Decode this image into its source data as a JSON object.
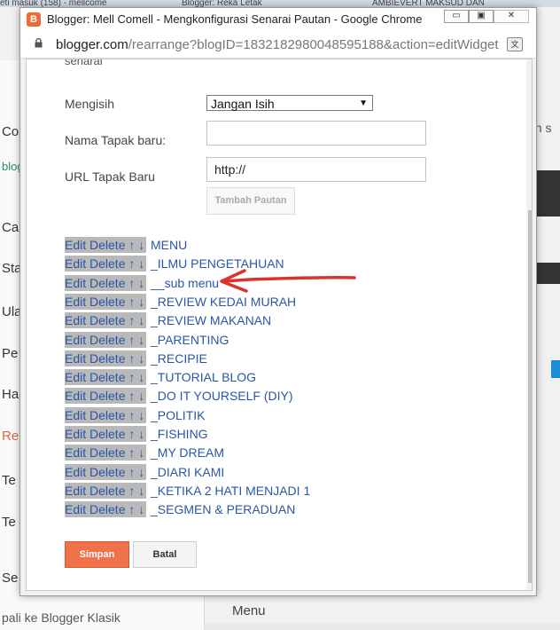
{
  "background": {
    "tabs": [
      "eti masuk (158) - mellcome",
      "Blogger: Reka Letak",
      "AMBIEVERT MAKSUD DAN"
    ],
    "left_menu": [
      "Co",
      "Ca",
      "Sta",
      "Ula",
      "Pe",
      "Ha",
      "Re",
      "Te",
      "Te",
      "Se"
    ],
    "left_bottom": "pali ke Blogger Klasik",
    "right_texts": [
      "an s",
      "Menu"
    ],
    "blog_text": "blog"
  },
  "window": {
    "title": "Blogger: Mell Comell - Mengkonfigurasi Senarai Pautan - Google Chrome",
    "url_host": "blogger.com",
    "url_path": "/rearrange?blogID=1832182980048595188&action=editWidget&...",
    "minimize": "▭",
    "maximize": "▣",
    "close": "✕"
  },
  "form": {
    "cut_label": "senarai",
    "sort_label": "Mengisih",
    "sort_value": "Jangan Isih",
    "name_label": "Nama Tapak baru:",
    "name_value": "",
    "url_label": "URL Tapak Baru",
    "url_value": "http://",
    "add_button": "Tambah Pautan"
  },
  "links": {
    "edit_label": "Edit",
    "delete_label": "Delete",
    "up_label": "↑",
    "down_label": "↓",
    "items": [
      "MENU",
      "_ILMU PENGETAHUAN",
      "__sub menu",
      "_REVIEW KEDAI MURAH",
      "_REVIEW MAKANAN",
      "_PARENTING",
      "_RECIPIE",
      "_TUTORIAL BLOG",
      "_DO IT YOURSELF (DIY)",
      "_POLITIK",
      "_FISHING",
      "_MY DREAM",
      "_DIARI KAMI",
      "_KETIKA 2 HATI MENJADI 1",
      "_SEGMEN & PERADUAN"
    ]
  },
  "buttons": {
    "save": "Simpan",
    "cancel": "Batal"
  },
  "colors": {
    "accent": "#f0724a",
    "link": "#2a56a5",
    "annotation": "#d9332b"
  }
}
